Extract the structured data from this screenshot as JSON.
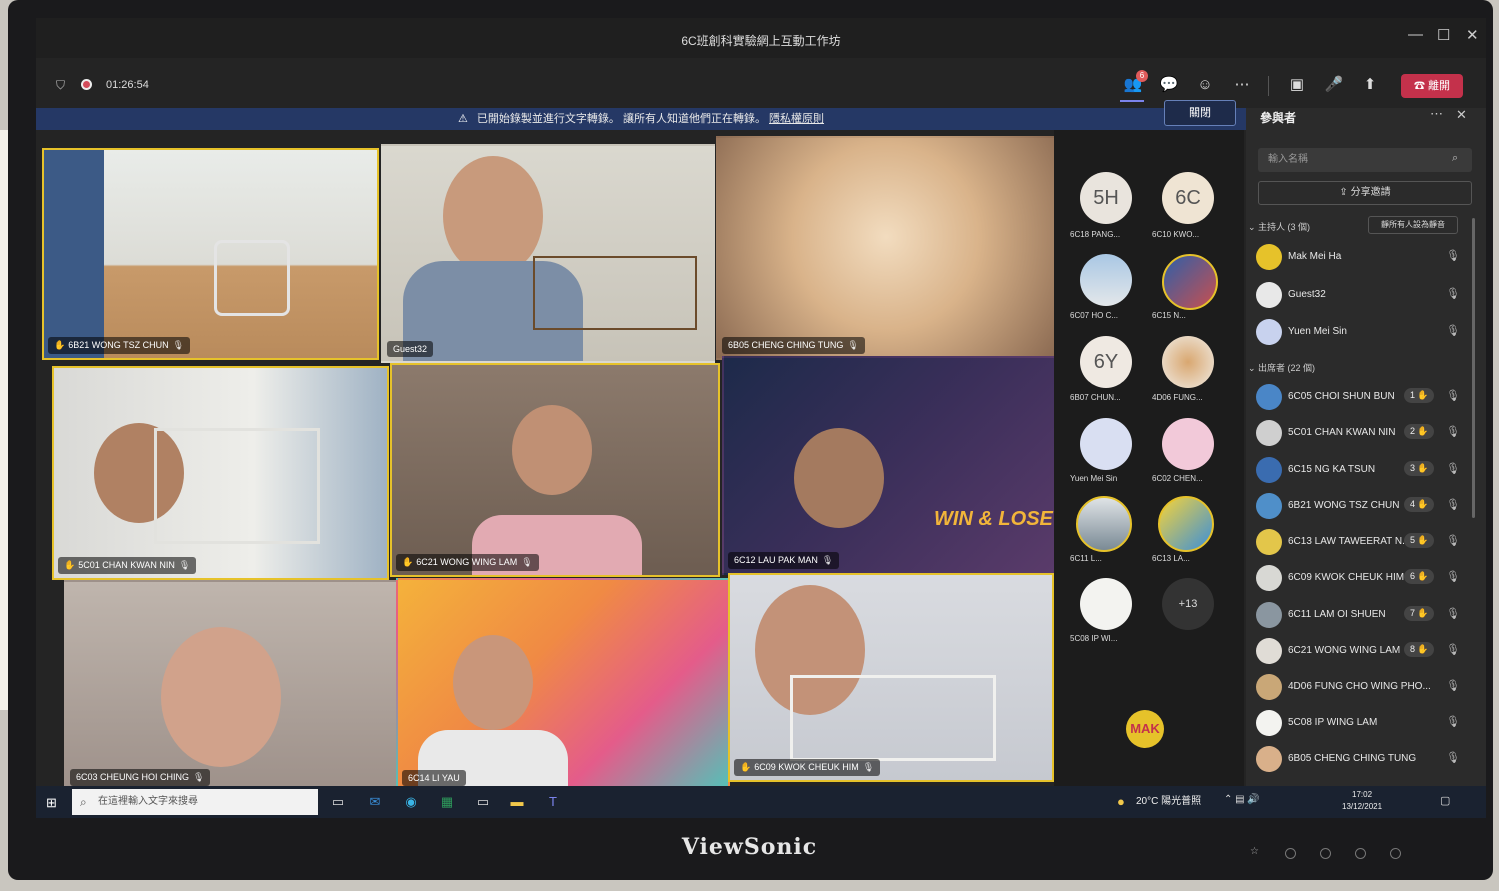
{
  "window": {
    "title": "6C班創科實驗網上互動工作坊"
  },
  "toolbar": {
    "timer": "01:26:54",
    "people_badge": "6",
    "leave_label": "離開"
  },
  "banner": {
    "text": "已開始錄製並進行文字轉錄。 讓所有人知道他們正在轉錄。",
    "link": "隱私權原則",
    "close_label": "關閉"
  },
  "tiles": [
    {
      "name": "6B21 WONG TSZ CHUN",
      "hand": true
    },
    {
      "name": "Guest32",
      "hand": false
    },
    {
      "name": "6B05 CHENG CHING TUNG",
      "hand": false
    },
    {
      "name": "5C01 CHAN KWAN NIN",
      "hand": true
    },
    {
      "name": "6C21 WONG WING LAM",
      "hand": true
    },
    {
      "name": "6C12 LAU PAK MAN",
      "hand": false
    },
    {
      "name": "6C03 CHEUNG HOI CHING",
      "hand": false
    },
    {
      "name": "6C14 LI YAU",
      "hand": false
    },
    {
      "name": "6C09 KWOK CHEUK HIM",
      "hand": true
    }
  ],
  "tile_overlay_text": "WIN & LOSE",
  "roster": [
    {
      "initials": "5H",
      "name": "6C18 PANG..."
    },
    {
      "initials": "6C",
      "name": "6C10 KWO..."
    },
    {
      "initials": "",
      "name": "6C07 HO C..."
    },
    {
      "initials": "",
      "name": "6C15 N..."
    },
    {
      "initials": "6Y",
      "name": "6B07 CHUN..."
    },
    {
      "initials": "",
      "name": "4D06 FUNG..."
    },
    {
      "initials": "",
      "name": "Yuen Mei Sin"
    },
    {
      "initials": "",
      "name": "6C02 CHEN..."
    },
    {
      "initials": "",
      "name": "6C11 L..."
    },
    {
      "initials": "",
      "name": "6C13 LA..."
    },
    {
      "initials": "",
      "name": "5C08 IP WI..."
    },
    {
      "initials": "+13",
      "name": ""
    }
  ],
  "self_avatar": "MAK",
  "panel": {
    "title": "參與者",
    "search_placeholder": "輸入名稱",
    "share_label": "分享邀請",
    "hosts_header": "主持人 (3 個)",
    "mute_all": "靜所有人設為靜音",
    "attendees_header": "出席者 (22 個)",
    "hosts": [
      "Mak Mei Ha",
      "Guest32",
      "Yuen Mei Sin"
    ],
    "attendees": [
      {
        "name": "6C05 CHOI SHUN BUN",
        "num": "1"
      },
      {
        "name": "5C01 CHAN KWAN NIN",
        "num": "2"
      },
      {
        "name": "6C15 NG KA TSUN",
        "num": "3"
      },
      {
        "name": "6B21 WONG TSZ CHUN",
        "num": "4"
      },
      {
        "name": "6C13 LAW TAWEERAT N...",
        "num": "5"
      },
      {
        "name": "6C09 KWOK CHEUK HIM",
        "num": "6"
      },
      {
        "name": "6C11 LAM OI SHUEN",
        "num": "7"
      },
      {
        "name": "6C21 WONG WING LAM",
        "num": "8"
      },
      {
        "name": "4D06 FUNG CHO WING PHO...",
        "num": ""
      },
      {
        "name": "5C08 IP WING LAM",
        "num": ""
      },
      {
        "name": "6B05 CHENG CHING TUNG",
        "num": ""
      }
    ]
  },
  "taskbar": {
    "search_placeholder": "在這裡輸入文字來搜尋",
    "weather": "20°C 陽光普照",
    "time": "17:02",
    "date": "13/12/2021"
  },
  "brand": "ViewSonic",
  "colors": {
    "active_border": "#e6c22a",
    "leave_red": "#c4314b",
    "banner_blue": "#253865"
  }
}
